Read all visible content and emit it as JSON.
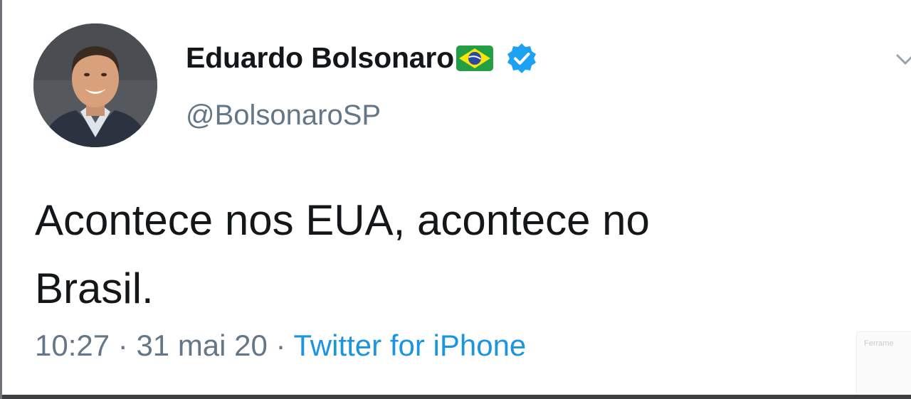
{
  "author": {
    "display_name": "Eduardo Bolsonaro",
    "handle": "@BolsonaroSP",
    "avatar_icon": "profile-photo",
    "flag_icon": "brazil-flag-emoji",
    "verified_icon": "verified-badge-icon"
  },
  "tweet": {
    "line1": "Acontece nos EUA, acontece no",
    "line2": "Brasil."
  },
  "meta": {
    "time": "10:27",
    "date": "31 mai 20",
    "separator": " · ",
    "source": "Twitter for iPhone"
  },
  "menu": {
    "chevron_icon": "chevron-down-icon"
  },
  "overlay": {
    "label": "Ferrame"
  },
  "colors": {
    "text_primary": "#14171a",
    "text_secondary": "#657786",
    "link_blue": "#1b95e0",
    "verified_blue": "#1da1f2"
  }
}
